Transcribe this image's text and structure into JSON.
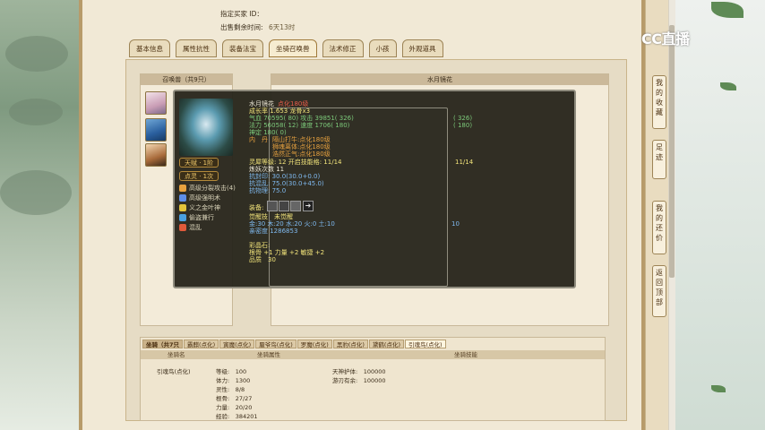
{
  "header": {
    "seller_label": "指定买家 ID：",
    "time_label": "出售剩余时间:",
    "time_value": "6天13时"
  },
  "tabs": [
    "基本信息",
    "属性抗性",
    "装备法宝",
    "坐骑召唤兽",
    "法术修正",
    "小孩",
    "外观道具"
  ],
  "active_tab": 3,
  "summon_list": {
    "title": "召唤兽（共9只）"
  },
  "detail": {
    "title": "水月镜花"
  },
  "popup": {
    "name": "水月镜花",
    "level": "点化180级",
    "growth": "成长率 1.653  龙骨x3",
    "hp": "气血 70595( 80)  攻击 39851( 326)",
    "mp": "法力 56058( 12)  速度 1706( 180)",
    "lingxing": "神定 180( 0)",
    "neidan_label": "内　丹",
    "neidan_1": "隔山打牛:点化180级",
    "neidan_2": "狮魂离体:点化180级",
    "neidan_3": "浩然正气:点化180级",
    "jinglian": "灵犀等级:  12  开启技能格:  11/14",
    "xiuxing": "炼妖次数 11",
    "kang1": "抗封印: 30.0(30.0+0.0)",
    "kang2": "抗混乱: 75.0(30.0+45.0)",
    "kang3": "抗物理: 75.0",
    "equip_label": "装备:",
    "awaken": "觉醒技　未觉醒",
    "wuxing": "金:30 木:20 水:20 火:0 土:10",
    "exp": "亲密度 1286853",
    "color_label": "彩晶石:",
    "color_value": "根骨 +1  力量 +2  敏捷 +2",
    "quality": "品质　30",
    "tianshen": "天赋 · 1阶",
    "dianhua": "点灵 · 1次",
    "skills": [
      "高级分裂攻击(4)",
      "高级强明术",
      "义之金叶神",
      "偷盗兼行",
      "混乱"
    ],
    "skill_colors": [
      "#e8a23f",
      "#5e8ee8",
      "#e3c23a",
      "#4aa0e0",
      "#e05a3a"
    ]
  },
  "right_extra": {
    "a": "( 326)",
    "b": "( 180)",
    "c": "11/14",
    "d": "10"
  },
  "bottom": {
    "tabs": [
      "坐骑（共7只",
      "霸麒(点化)",
      "寅魔(点化)",
      "蜃爷鸟(点化)",
      "罗魔(点化)",
      "黑豹(点化)",
      "黛鹤(点化)",
      "引魂鸟(点化)"
    ],
    "active_tab": 7,
    "cols": [
      "坐骑名",
      "坐骑属性",
      "坐骑技能"
    ],
    "mount_name": "引魂鸟(点化)",
    "stats": [
      "等级:　100",
      "体力:　1300",
      "灵性:　8/8",
      "根骨:　27/27",
      "力量:　20/20",
      "经验:　384201"
    ],
    "skills": [
      "天神护体:　100000",
      "游刃有余:　100000"
    ]
  },
  "side_nav": [
    "我的收藏",
    "足迹",
    "我的还价",
    "返回顶部"
  ],
  "cc_logo": "CC直播"
}
